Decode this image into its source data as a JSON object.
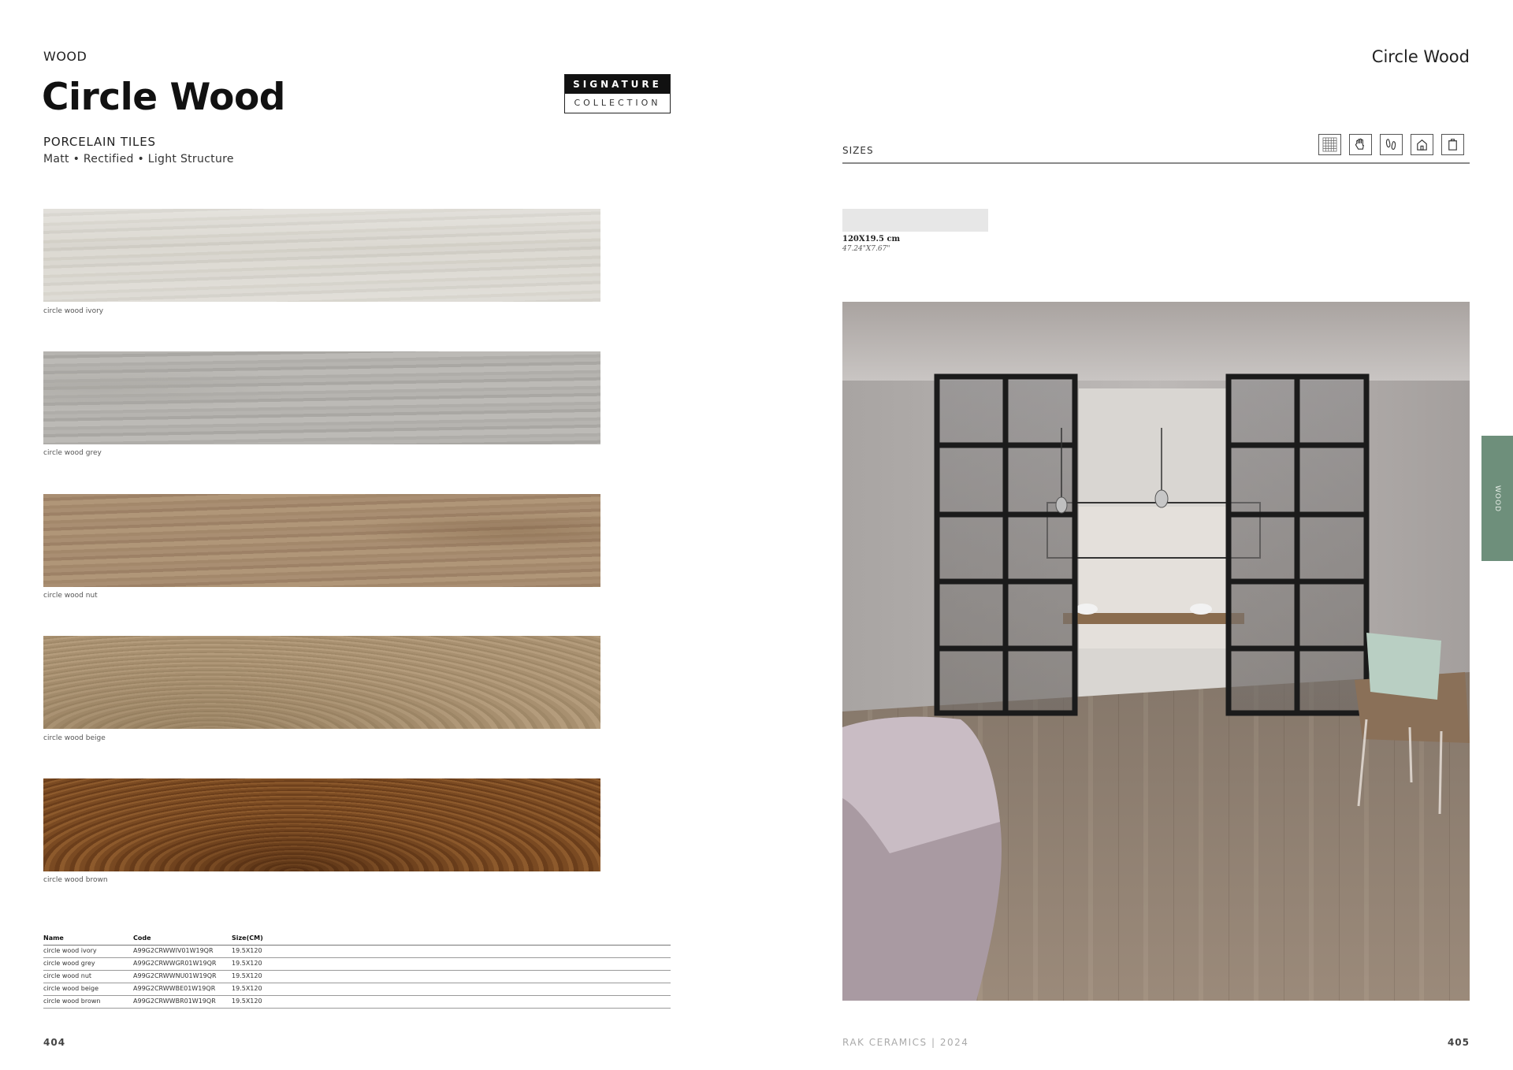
{
  "left_page": {
    "category": "WOOD",
    "title": "Circle Wood",
    "badge": {
      "line1": "SIGNATURE",
      "line2": "COLLECTION"
    },
    "subtitle": "PORCELAIN TILES",
    "finish": "Matt • Rectified • Light Structure",
    "tiles": [
      {
        "name": "circle wood ivory",
        "color": "#d6d3cc"
      },
      {
        "name": "circle wood grey",
        "color": "#b2b0ac"
      },
      {
        "name": "circle wood nut",
        "color": "#a68b6e"
      },
      {
        "name": "circle wood beige",
        "color": "#a99172"
      },
      {
        "name": "circle wood brown",
        "color": "#7a4a22"
      }
    ],
    "table": {
      "headers": [
        "Name",
        "Code",
        "Size(CM)"
      ],
      "rows": [
        [
          "circle wood ivory",
          "A99G2CRWWIV01W19QR",
          "19.5X120"
        ],
        [
          "circle wood grey",
          "A99G2CRWWGR01W19QR",
          "19.5X120"
        ],
        [
          "circle wood nut",
          "A99G2CRWWNU01W19QR",
          "19.5X120"
        ],
        [
          "circle wood beige",
          "A99G2CRWWBE01W19QR",
          "19.5X120"
        ],
        [
          "circle wood brown",
          "A99G2CRWWBR01W19QR",
          "19.5X120"
        ]
      ]
    },
    "page_number": "404"
  },
  "right_page": {
    "title": "Circle Wood",
    "sizes_label": "SIZES",
    "icons": [
      "tile-grid-icon",
      "hand-icon",
      "footprints-icon",
      "house-icon",
      "door-icon"
    ],
    "size_cm": "120X19.5 cm",
    "size_in": "47.24\"X7.67\"",
    "side_tab": "WOOD",
    "side_tab_color": "#6e8f7b",
    "footer_brand": "RAK CERAMICS | 2024",
    "page_number": "405"
  }
}
